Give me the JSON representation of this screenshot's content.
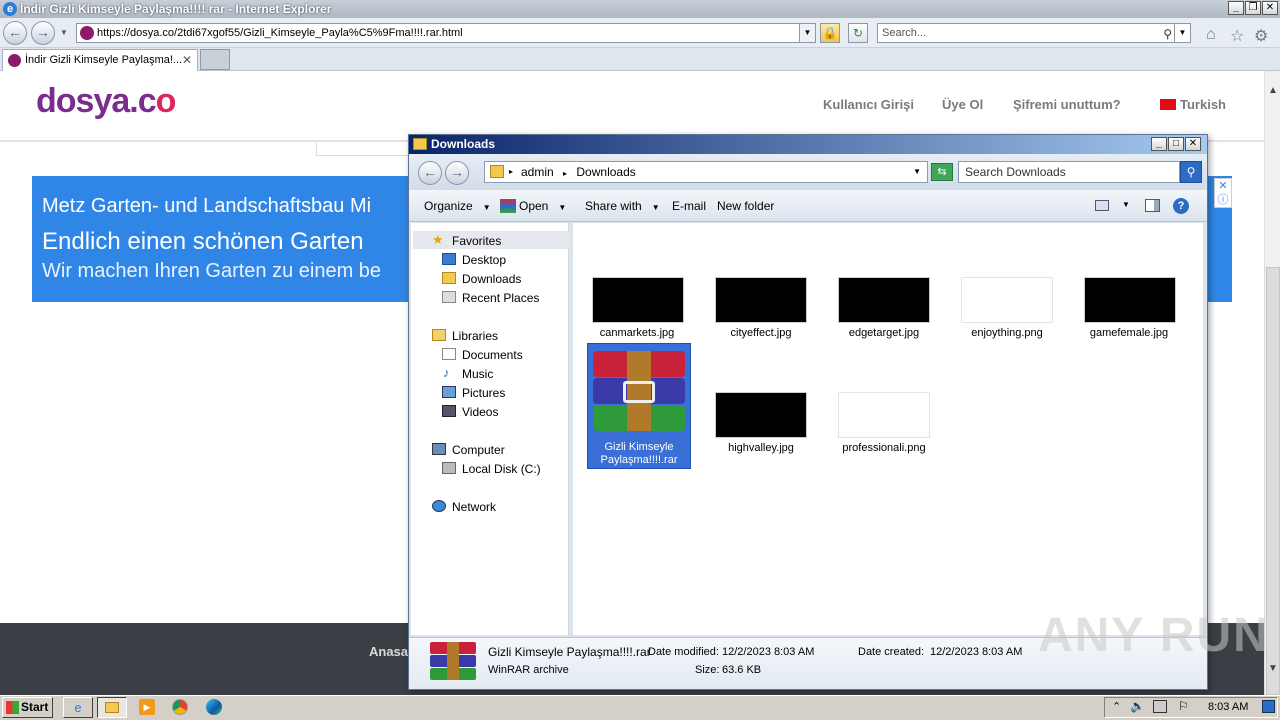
{
  "browser": {
    "window_title": "İndir Gizli Kimseyle Paylaşma!!!! rar - Internet Explorer",
    "url": "https://dosya.co/2tdi67xgof55/Gizli_Kimseyle_Payla%C5%9Fma!!!!.rar.html",
    "search_placeholder": "Search...",
    "tab_title": "İndir Gizli Kimseyle Paylaşma!..."
  },
  "site": {
    "logo_main": "dosya.c",
    "logo_accent": "o",
    "nav": {
      "login": "Kullanıcı Girişi",
      "register": "Üye Ol",
      "forgot": "Şifremi unuttum?",
      "language": "Turkish"
    },
    "ad": {
      "line1": "Metz Garten- und Landschaftsbau Mi",
      "line2": "Endlich einen schönen Garten",
      "line3": "Wir machen Ihren Garten zu einem be"
    },
    "footer_link": "Anasay",
    "watermark": "ANY RUN"
  },
  "explorer": {
    "title": "Downloads",
    "path": [
      "admin",
      "Downloads"
    ],
    "search_placeholder": "Search Downloads",
    "toolbar": {
      "organize": "Organize",
      "open": "Open",
      "share": "Share with",
      "email": "E-mail",
      "new_folder": "New folder"
    },
    "nav": {
      "favorites": "Favorites",
      "desktop": "Desktop",
      "downloads": "Downloads",
      "recent": "Recent Places",
      "libraries": "Libraries",
      "documents": "Documents",
      "music": "Music",
      "pictures": "Pictures",
      "videos": "Videos",
      "computer": "Computer",
      "local_disk": "Local Disk (C:)",
      "network": "Network"
    },
    "files": [
      {
        "name": "canmarkets.jpg",
        "thumb": "#000000"
      },
      {
        "name": "cityeffect.jpg",
        "thumb": "#000000"
      },
      {
        "name": "edgetarget.jpg",
        "thumb": "#000000"
      },
      {
        "name": "enjoything.png",
        "thumb": "#ffffff"
      },
      {
        "name": "gamefemale.jpg",
        "thumb": "#000000"
      },
      {
        "name": "Gizli Kimseyle Paylaşma!!!!.rar",
        "thumb": "rar-icon"
      },
      {
        "name": "highvalley.jpg",
        "thumb": "#000000"
      },
      {
        "name": "professionali.png",
        "thumb": "#ffffff"
      }
    ],
    "details": {
      "filename": "Gizli Kimseyle Paylaşma!!!!.rar",
      "type": "WinRAR archive",
      "modified_label": "Date modified:",
      "modified": "12/2/2023 8:03 AM",
      "size_label": "Size:",
      "size": "63.6 KB",
      "created_label": "Date created:",
      "created": "12/2/2023 8:03 AM"
    }
  },
  "taskbar": {
    "start": "Start",
    "clock": "8:03 AM"
  }
}
